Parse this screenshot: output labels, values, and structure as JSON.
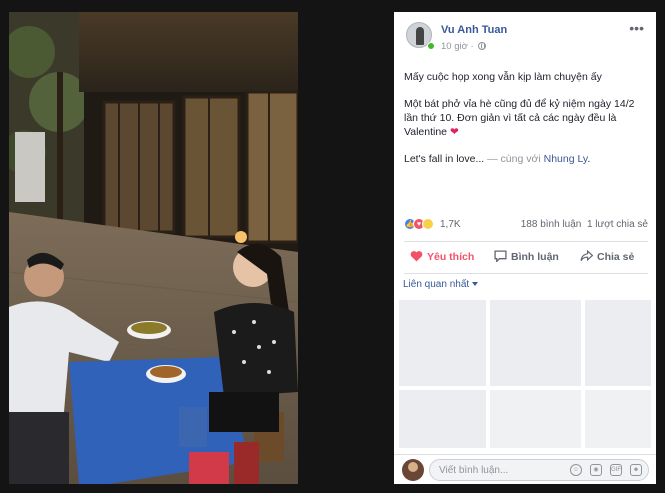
{
  "post": {
    "author": "Vu Anh Tuan",
    "time": "10 giờ ·",
    "paragraph1": "Mấy cuộc họp xong vẫn kịp làm chuyện ấy",
    "paragraph2": "Một bát phở vỉa hè cũng đủ để kỷ niệm ngày 14/2 lần thứ 10. Đơn giản vì tất cả các ngày đều là Valentine",
    "heart": "❤",
    "paragraph3_text": "Let's fall in love...",
    "with_text": " — cùng với ",
    "tagged_user": "Nhung Ly",
    "period": "."
  },
  "reactions": {
    "icons": [
      "like-icon",
      "love-icon",
      "haha-icon"
    ],
    "count": "1,7K",
    "comments": "188 bình luận",
    "shares": "1 lượt chia sẻ"
  },
  "actions": {
    "like": "Yêu thích",
    "comment": "Bình luận",
    "share": "Chia sẻ"
  },
  "related": {
    "label": "Liên quan nhất"
  },
  "comment_box": {
    "placeholder": "Viết bình luận..."
  },
  "colors": {
    "link": "#385898",
    "love": "#f25268",
    "like": "#4080ff",
    "muted": "#90949c"
  }
}
